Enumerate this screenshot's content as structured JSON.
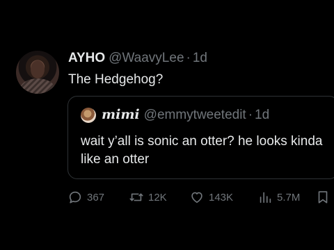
{
  "tweet": {
    "display_name": "AYHO",
    "handle": "@WaavyLee",
    "separator": "·",
    "time": "1d",
    "text": "The Hedgehog?"
  },
  "quote": {
    "display_name": "mimi",
    "handle": "@emmytweetedit",
    "separator": "·",
    "time": "1d",
    "text": "wait y’all is sonic an otter? he looks kinda like an otter"
  },
  "actions": {
    "replies": "367",
    "retweets": "12K",
    "likes": "143K",
    "views": "5.7M"
  },
  "icons": {
    "reply": "reply-icon",
    "retweet": "retweet-icon",
    "like": "heart-icon",
    "views": "views-chart-icon",
    "bookmark": "bookmark-icon"
  },
  "colors": {
    "background": "#000000",
    "primary_text": "#e7e9ea",
    "secondary_text": "#71767b",
    "border": "#2f3336"
  }
}
